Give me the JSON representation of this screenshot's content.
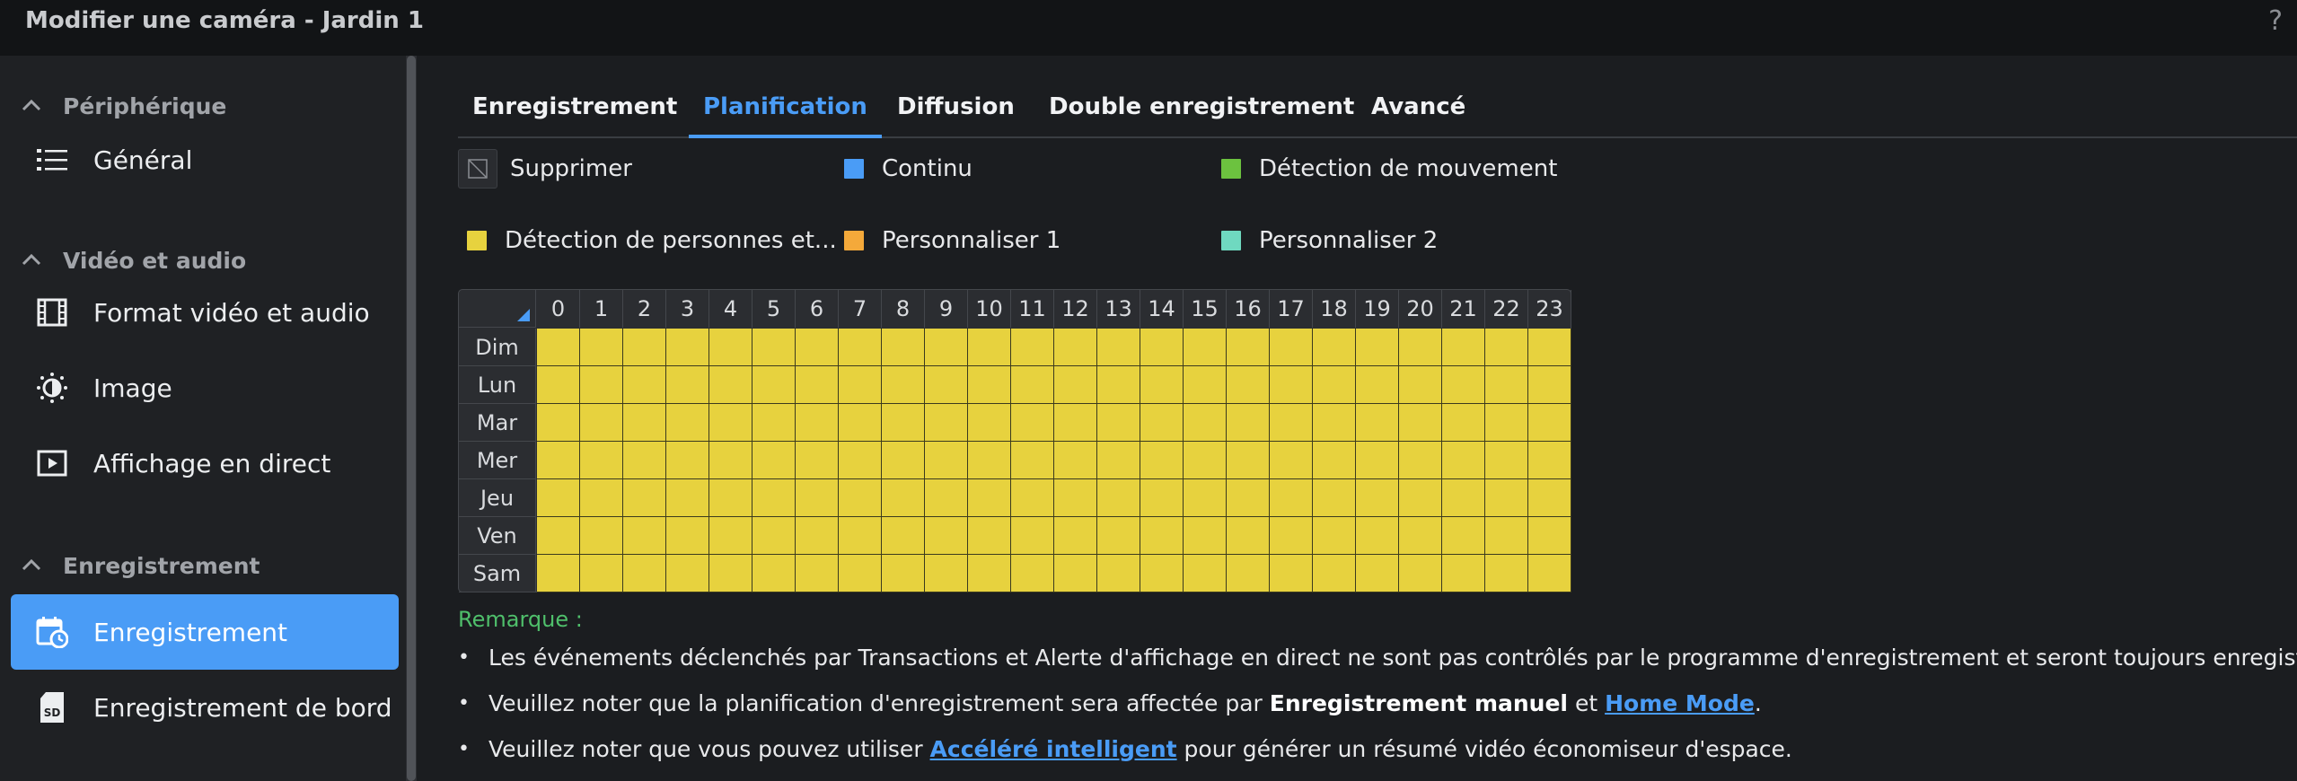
{
  "window": {
    "title": "Modifier une caméra - Jardin 1",
    "help": "?"
  },
  "sidebar": {
    "sections": [
      {
        "label": "Périphérique",
        "items": [
          {
            "label": "Général",
            "icon": "list-icon"
          }
        ]
      },
      {
        "label": "Vidéo et audio",
        "items": [
          {
            "label": "Format vidéo et audio",
            "icon": "film-icon"
          },
          {
            "label": "Image",
            "icon": "brightness-icon"
          },
          {
            "label": "Affichage en direct",
            "icon": "play-icon"
          }
        ]
      },
      {
        "label": "Enregistrement",
        "items": [
          {
            "label": "Enregistrement",
            "icon": "calendar-clock-icon",
            "active": true
          },
          {
            "label": "Enregistrement de bord",
            "icon": "sd-card-icon"
          }
        ]
      }
    ]
  },
  "tabs": [
    {
      "label": "Enregistrement"
    },
    {
      "label": "Planification",
      "active": true
    },
    {
      "label": "Diffusion"
    },
    {
      "label": "Double enregistrement"
    },
    {
      "label": "Avancé"
    }
  ],
  "legend": [
    {
      "label": "Supprimer",
      "color": "#2a2c30"
    },
    {
      "label": "Continu",
      "color": "#4a9cf6"
    },
    {
      "label": "Détection de mouvement",
      "color": "#6cc23f"
    },
    {
      "label": "Détection de personnes et...",
      "color": "#e7d23e"
    },
    {
      "label": "Personnaliser 1",
      "color": "#f4a93a"
    },
    {
      "label": "Personnaliser 2",
      "color": "#6fd9c0"
    }
  ],
  "schedule": {
    "hours": [
      "0",
      "1",
      "2",
      "3",
      "4",
      "5",
      "6",
      "7",
      "8",
      "9",
      "10",
      "11",
      "12",
      "13",
      "14",
      "15",
      "16",
      "17",
      "18",
      "19",
      "20",
      "21",
      "22",
      "23"
    ],
    "days": [
      "Dim",
      "Lun",
      "Mar",
      "Mer",
      "Jeu",
      "Ven",
      "Sam"
    ],
    "fill_mode": "Détection de personnes et...",
    "fill_color": "#e7d23e"
  },
  "notes": {
    "title": "Remarque :",
    "bullet1": "Les événements déclenchés par Transactions et Alerte d'affichage en direct ne sont pas contrôlés par le programme d'enregistrement et seront toujours enregistrés.",
    "bullet2_a": "Veuillez noter que la planification d'enregistrement sera affectée par ",
    "bullet2_b": "Enregistrement manuel",
    "bullet2_c": " et ",
    "bullet2_link": "Home Mode",
    "bullet2_d": ".",
    "bullet3_a": "Veuillez noter que vous pouvez utiliser ",
    "bullet3_link": "Accéléré intelligent",
    "bullet3_b": " pour générer un résumé vidéo économiseur d'espace."
  }
}
